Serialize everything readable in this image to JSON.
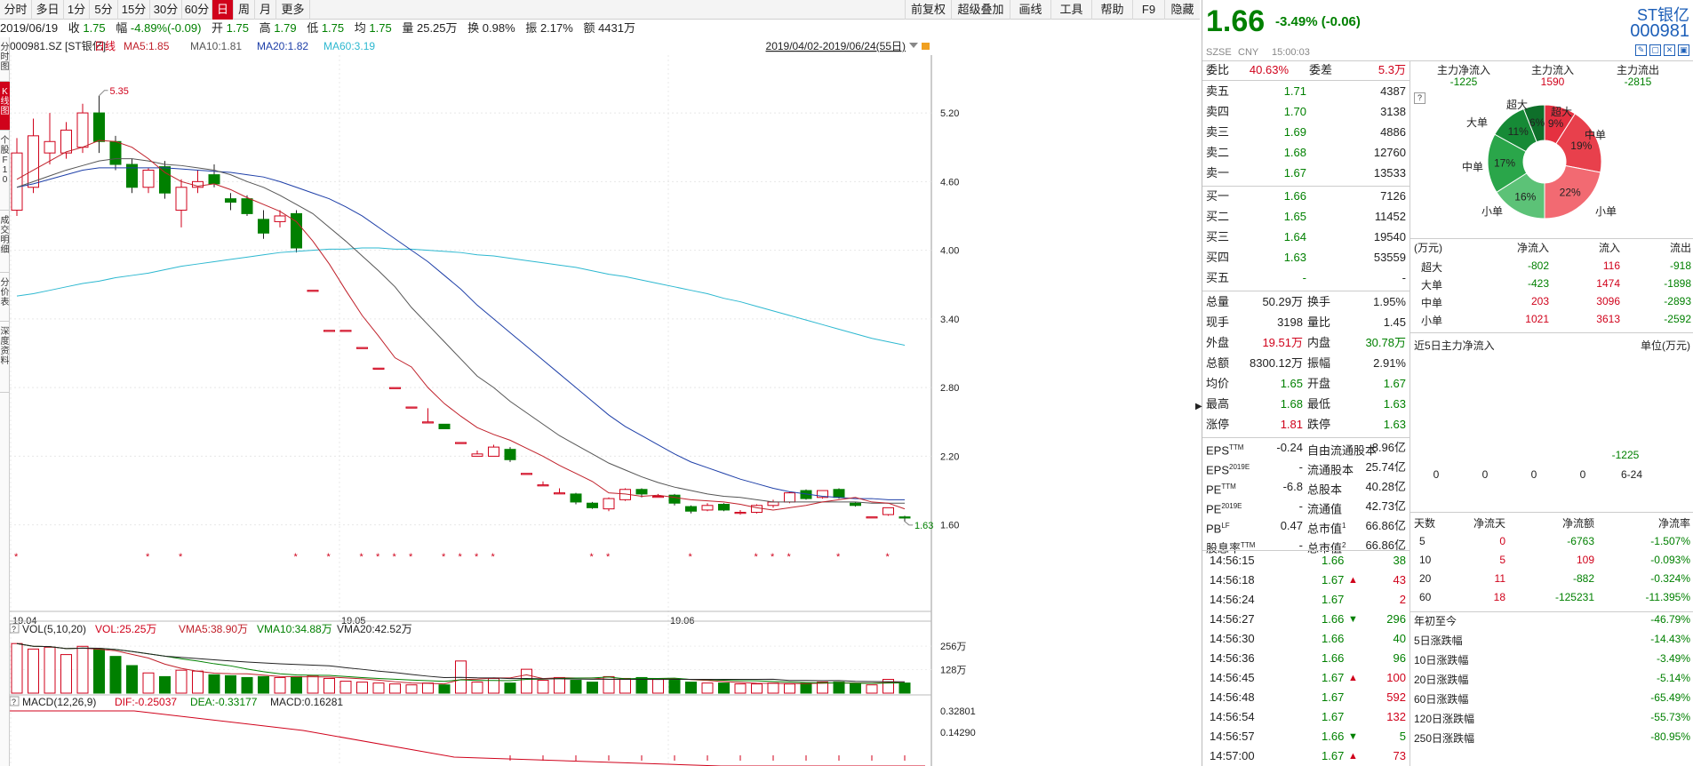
{
  "toolbar": {
    "periods": [
      {
        "label": "分时",
        "active": false
      },
      {
        "label": "多日",
        "active": false
      },
      {
        "label": "1分",
        "active": false
      },
      {
        "label": "5分",
        "active": false
      },
      {
        "label": "15分",
        "active": false
      },
      {
        "label": "30分",
        "active": false
      },
      {
        "label": "60分",
        "active": false
      },
      {
        "label": "日",
        "active": true
      },
      {
        "label": "周",
        "active": false
      },
      {
        "label": "月",
        "active": false
      },
      {
        "label": "更多",
        "active": false
      }
    ],
    "right_buttons": [
      "前复权",
      "超级叠加",
      "画线",
      "工具",
      "帮助",
      "F9",
      "隐藏"
    ]
  },
  "quote_line": {
    "date": "2019/06/19",
    "close_label": "收",
    "close": "1.75",
    "change_label": "幅",
    "change": "-4.89%(-0.09)",
    "open_label": "开",
    "open": "1.75",
    "high_label": "高",
    "high": "1.79",
    "low_label": "低",
    "low": "1.75",
    "avg_label": "均",
    "avg": "1.75",
    "volume_label": "量",
    "volume": "25.25万",
    "turnover_label": "换",
    "turnover": "0.98%",
    "amplitude_label": "振",
    "amplitude": "2.17%",
    "amount_label": "额",
    "amount": "4431万"
  },
  "left_nav": [
    "分时图",
    "K线图",
    "个股F10",
    "成交明细",
    "分价表",
    "深度资料"
  ],
  "chart_header": {
    "code": "000981.SZ [ST银亿]",
    "period": "日线",
    "ma5": "MA5:1.85",
    "ma10": "MA10:1.81",
    "ma20": "MA20:1.82",
    "ma60": "MA60:3.19",
    "range": "2019/04/02-2019/06/24(55日)",
    "peak_label": "5.35",
    "last_label": "1.63"
  },
  "colors": {
    "up": "#d0021b",
    "down": "#008000",
    "ma5": "#c0202a",
    "ma10": "#555",
    "ma20": "#1e3fa8",
    "ma60": "#2db8d0",
    "vol_ma5": "#c0202a",
    "vol_ma10": "#008000"
  },
  "chart_data": [
    {
      "type": "candlestick",
      "title": "000981.SZ [ST银亿] 日线",
      "ylim": [
        1.45,
        5.55
      ],
      "y_ticks": [
        "5.20",
        "4.60",
        "4.00",
        "3.40",
        "2.80",
        "2.20",
        "1.60"
      ],
      "x_labels": [
        {
          "label": "19.04",
          "index": 0
        },
        {
          "label": "19.05",
          "index": 20
        },
        {
          "label": "19.06",
          "index": 40
        }
      ],
      "candles": [
        [
          4.35,
          4.85,
          4.3,
          4.98
        ],
        [
          4.55,
          5.0,
          4.5,
          5.15
        ],
        [
          4.85,
          4.95,
          4.75,
          5.2
        ],
        [
          4.85,
          5.05,
          4.8,
          5.12
        ],
        [
          4.9,
          5.2,
          4.85,
          5.28
        ],
        [
          5.2,
          4.95,
          4.85,
          5.35
        ],
        [
          4.95,
          4.75,
          4.7,
          5.0
        ],
        [
          4.75,
          4.55,
          4.5,
          4.8
        ],
        [
          4.55,
          4.7,
          4.5,
          4.72
        ],
        [
          4.73,
          4.5,
          4.45,
          4.78
        ],
        [
          4.35,
          4.55,
          4.2,
          4.62
        ],
        [
          4.55,
          4.6,
          4.5,
          4.7
        ],
        [
          4.66,
          4.58,
          4.55,
          4.75
        ],
        [
          4.45,
          4.42,
          4.35,
          4.5
        ],
        [
          4.45,
          4.32,
          4.3,
          4.48
        ],
        [
          4.27,
          4.15,
          4.1,
          4.35
        ],
        [
          4.25,
          4.3,
          4.2,
          4.35
        ],
        [
          4.32,
          4.02,
          3.98,
          4.35
        ],
        [
          3.65,
          3.65,
          3.65,
          3.65
        ],
        [
          3.3,
          3.3,
          3.3,
          3.3
        ],
        [
          3.3,
          3.3,
          3.3,
          3.3
        ],
        [
          3.15,
          3.15,
          3.15,
          3.15
        ],
        [
          2.97,
          2.97,
          2.97,
          2.97
        ],
        [
          2.8,
          2.8,
          2.8,
          2.8
        ],
        [
          2.63,
          2.63,
          2.63,
          2.63
        ],
        [
          2.5,
          2.5,
          2.5,
          2.62
        ],
        [
          2.48,
          2.44,
          2.44,
          2.48
        ],
        [
          2.32,
          2.32,
          2.32,
          2.32
        ],
        [
          2.2,
          2.22,
          2.2,
          2.25
        ],
        [
          2.2,
          2.28,
          2.2,
          2.3
        ],
        [
          2.26,
          2.17,
          2.15,
          2.28
        ],
        [
          2.05,
          2.05,
          2.05,
          2.05
        ],
        [
          1.95,
          1.95,
          1.95,
          1.98
        ],
        [
          1.88,
          1.88,
          1.88,
          1.92
        ],
        [
          1.87,
          1.8,
          1.78,
          1.88
        ],
        [
          1.79,
          1.75,
          1.74,
          1.8
        ],
        [
          1.74,
          1.83,
          1.72,
          1.84
        ],
        [
          1.82,
          1.91,
          1.81,
          1.92
        ],
        [
          1.91,
          1.87,
          1.84,
          1.92
        ],
        [
          1.85,
          1.85,
          1.84,
          1.87
        ],
        [
          1.86,
          1.79,
          1.77,
          1.87
        ],
        [
          1.76,
          1.72,
          1.7,
          1.77
        ],
        [
          1.73,
          1.77,
          1.72,
          1.79
        ],
        [
          1.78,
          1.73,
          1.72,
          1.79
        ],
        [
          1.71,
          1.71,
          1.69,
          1.73
        ],
        [
          1.71,
          1.77,
          1.7,
          1.78
        ],
        [
          1.77,
          1.8,
          1.75,
          1.82
        ],
        [
          1.8,
          1.88,
          1.79,
          1.89
        ],
        [
          1.9,
          1.83,
          1.82,
          1.91
        ],
        [
          1.84,
          1.9,
          1.83,
          1.9
        ],
        [
          1.91,
          1.84,
          1.83,
          1.92
        ],
        [
          1.79,
          1.77,
          1.76,
          1.8
        ],
        [
          1.67,
          1.67,
          1.67,
          1.67
        ],
        [
          1.69,
          1.75,
          1.68,
          1.75
        ],
        [
          1.67,
          1.66,
          1.63,
          1.68
        ]
      ],
      "ma5": [
        4.62,
        4.7,
        4.78,
        4.86,
        4.9,
        4.96,
        4.95,
        4.9,
        4.8,
        4.68,
        4.6,
        4.56,
        4.58,
        4.53,
        4.46,
        4.4,
        4.34,
        4.25,
        4.08,
        3.88,
        3.65,
        3.43,
        3.25,
        3.06,
        2.98,
        2.8,
        2.66,
        2.55,
        2.45,
        2.39,
        2.34,
        2.27,
        2.2,
        2.12,
        2.05,
        1.98,
        1.88,
        1.87,
        1.85,
        1.86,
        1.84,
        1.82,
        1.81,
        1.8,
        1.78,
        1.75,
        1.73,
        1.75,
        1.77,
        1.8,
        1.82,
        1.84,
        1.8,
        1.79,
        1.74
      ],
      "ma10": [
        4.55,
        4.6,
        4.65,
        4.7,
        4.74,
        4.78,
        4.8,
        4.8,
        4.78,
        4.75,
        4.74,
        4.72,
        4.7,
        4.66,
        4.6,
        4.55,
        4.48,
        4.4,
        4.32,
        4.2,
        4.08,
        3.95,
        3.82,
        3.68,
        3.5,
        3.35,
        3.2,
        3.05,
        2.9,
        2.8,
        2.68,
        2.58,
        2.48,
        2.38,
        2.3,
        2.22,
        2.14,
        2.08,
        2.02,
        1.97,
        1.93,
        1.9,
        1.87,
        1.85,
        1.84,
        1.82,
        1.8,
        1.8,
        1.8,
        1.8,
        1.8,
        1.8,
        1.79,
        1.79,
        1.79
      ],
      "ma20": [
        4.55,
        4.58,
        4.62,
        4.66,
        4.7,
        4.72,
        4.72,
        4.72,
        4.72,
        4.72,
        4.71,
        4.7,
        4.69,
        4.68,
        4.66,
        4.64,
        4.6,
        4.55,
        4.5,
        4.45,
        4.38,
        4.3,
        4.2,
        4.1,
        4.0,
        3.9,
        3.78,
        3.66,
        3.52,
        3.4,
        3.28,
        3.16,
        3.04,
        2.92,
        2.8,
        2.68,
        2.56,
        2.46,
        2.38,
        2.3,
        2.22,
        2.15,
        2.1,
        2.05,
        2.0,
        1.96,
        1.92,
        1.89,
        1.87,
        1.85,
        1.84,
        1.83,
        1.83,
        1.82,
        1.82
      ],
      "ma60": [
        3.6,
        3.62,
        3.65,
        3.68,
        3.71,
        3.73,
        3.76,
        3.78,
        3.8,
        3.83,
        3.86,
        3.88,
        3.9,
        3.92,
        3.94,
        3.96,
        3.98,
        3.99,
        4.0,
        4.01,
        4.01,
        4.02,
        4.02,
        4.01,
        4.01,
        4.0,
        3.99,
        3.98,
        3.96,
        3.95,
        3.93,
        3.91,
        3.89,
        3.87,
        3.85,
        3.82,
        3.79,
        3.77,
        3.74,
        3.71,
        3.68,
        3.65,
        3.62,
        3.58,
        3.55,
        3.51,
        3.47,
        3.43,
        3.39,
        3.35,
        3.31,
        3.27,
        3.23,
        3.2,
        3.17
      ],
      "markers": [
        0,
        8,
        10,
        17,
        19,
        21,
        22,
        23,
        24,
        26,
        27,
        28,
        29,
        35,
        36,
        41,
        45,
        46,
        47,
        50,
        53
      ]
    },
    {
      "type": "bar",
      "title": "VOL(5,10,20)",
      "vol": "VOL:25.25万",
      "vma5": "VMA5:38.90万",
      "vma10": "VMA10:34.88万",
      "vma20": "VMA20:42.52万",
      "y_ticks": [
        "256万",
        "128万"
      ],
      "ylim": [
        0,
        300
      ],
      "values": [
        270,
        240,
        250,
        210,
        255,
        240,
        200,
        150,
        110,
        90,
        125,
        120,
        100,
        95,
        85,
        90,
        85,
        90,
        95,
        80,
        65,
        60,
        55,
        50,
        45,
        55,
        45,
        175,
        60,
        80,
        55,
        130,
        70,
        85,
        70,
        60,
        90,
        80,
        85,
        75,
        70,
        60,
        55,
        55,
        50,
        50,
        55,
        50,
        55,
        60,
        60,
        50,
        45,
        75,
        55
      ]
    },
    {
      "type": "bar",
      "title": "MACD(12,26,9)",
      "dif": "DIF:-0.25037",
      "dea": "DEA:-0.33177",
      "macd": "MACD:0.16281",
      "y_ticks": [
        "0.32801",
        "0.14290"
      ]
    }
  ],
  "right_panel": {
    "price": "1.66",
    "change": "-3.49% (-0.06)",
    "name": "ST银亿",
    "code": "000981",
    "exchange": "SZSE",
    "currency": "CNY",
    "time": "15:00:03",
    "ratio_label": "委比",
    "ratio": "40.63%",
    "diff_label": "委差",
    "diff": "5.3万",
    "sells": [
      {
        "label": "卖五",
        "price": "1.71",
        "vol": "4387"
      },
      {
        "label": "卖四",
        "price": "1.70",
        "vol": "3138"
      },
      {
        "label": "卖三",
        "price": "1.69",
        "vol": "4886"
      },
      {
        "label": "卖二",
        "price": "1.68",
        "vol": "12760"
      },
      {
        "label": "卖一",
        "price": "1.67",
        "vol": "13533"
      }
    ],
    "buys": [
      {
        "label": "买一",
        "price": "1.66",
        "vol": "7126"
      },
      {
        "label": "买二",
        "price": "1.65",
        "vol": "11452"
      },
      {
        "label": "买三",
        "price": "1.64",
        "vol": "19540"
      },
      {
        "label": "买四",
        "price": "1.63",
        "vol": "53559"
      },
      {
        "label": "买五",
        "price": "-",
        "vol": "-"
      }
    ],
    "stats": [
      {
        "l1": "总量",
        "v1": "50.29万",
        "c1": "k",
        "l2": "换手",
        "v2": "1.95%",
        "c2": "k"
      },
      {
        "l1": "现手",
        "v1": "3198",
        "c1": "k",
        "l2": "量比",
        "v2": "1.45",
        "c2": "k"
      },
      {
        "l1": "外盘",
        "v1": "19.51万",
        "c1": "r",
        "l2": "内盘",
        "v2": "30.78万",
        "c2": "g"
      },
      {
        "l1": "总额",
        "v1": "8300.12万",
        "c1": "k",
        "l2": "振幅",
        "v2": "2.91%",
        "c2": "k"
      },
      {
        "l1": "均价",
        "v1": "1.65",
        "c1": "g",
        "l2": "开盘",
        "v2": "1.67",
        "c2": "g"
      },
      {
        "l1": "最高",
        "v1": "1.68",
        "c1": "g",
        "l2": "最低",
        "v2": "1.63",
        "c2": "g"
      },
      {
        "l1": "涨停",
        "v1": "1.81",
        "c1": "r",
        "l2": "跌停",
        "v2": "1.63",
        "c2": "g"
      }
    ],
    "fundamentals": [
      {
        "l1": "EPS",
        "s1": "TTM",
        "v1": "-0.24",
        "l2": "自由流通股本",
        "s2": "",
        "v2": "8.96亿"
      },
      {
        "l1": "EPS",
        "s1": "2019E",
        "v1": "-",
        "l2": "流通股本",
        "s2": "",
        "v2": "25.74亿"
      },
      {
        "l1": "PE",
        "s1": "TTM",
        "v1": "-6.8",
        "l2": "总股本",
        "s2": "",
        "v2": "40.28亿"
      },
      {
        "l1": "PE",
        "s1": "2019E",
        "v1": "-",
        "l2": "流通值",
        "s2": "",
        "v2": "42.73亿"
      },
      {
        "l1": "PB",
        "s1": "LF",
        "v1": "0.47",
        "l2": "总市值",
        "s2": "1",
        "v2": "66.86亿"
      },
      {
        "l1": "股息率",
        "s1": "TTM",
        "v1": "-",
        "l2": "总市值",
        "s2": "2",
        "v2": "66.86亿"
      }
    ],
    "ticks": [
      {
        "time": "14:56:15",
        "price": "1.66",
        "dir": "",
        "vol": "38",
        "vc": "g"
      },
      {
        "time": "14:56:18",
        "price": "1.67",
        "dir": "up",
        "vol": "43",
        "vc": "r"
      },
      {
        "time": "14:56:24",
        "price": "1.67",
        "dir": "",
        "vol": "2",
        "vc": "r"
      },
      {
        "time": "14:56:27",
        "price": "1.66",
        "dir": "down",
        "vol": "296",
        "vc": "g"
      },
      {
        "time": "14:56:30",
        "price": "1.66",
        "dir": "",
        "vol": "40",
        "vc": "g"
      },
      {
        "time": "14:56:36",
        "price": "1.66",
        "dir": "",
        "vol": "96",
        "vc": "g"
      },
      {
        "time": "14:56:45",
        "price": "1.67",
        "dir": "up",
        "vol": "100",
        "vc": "r"
      },
      {
        "time": "14:56:48",
        "price": "1.67",
        "dir": "",
        "vol": "592",
        "vc": "r"
      },
      {
        "time": "14:56:54",
        "price": "1.67",
        "dir": "",
        "vol": "132",
        "vc": "r"
      },
      {
        "time": "14:56:57",
        "price": "1.66",
        "dir": "down",
        "vol": "5",
        "vc": "g"
      },
      {
        "time": "14:57:00",
        "price": "1.67",
        "dir": "up",
        "vol": "73",
        "vc": "r"
      }
    ],
    "flow": {
      "inflow_label": "主力净流入",
      "inflow": "-1225",
      "in_label": "主力流入",
      "in": "1590",
      "out_label": "主力流出",
      "out": "-2815",
      "pie": [
        {
          "name": "超大",
          "pct": "9%",
          "value": 9,
          "color": "#e53040"
        },
        {
          "name": "中单",
          "pct": "19%",
          "value": 19,
          "color": "#e8404c"
        },
        {
          "name": "小单",
          "pct": "22%",
          "value": 22,
          "color": "#f26a72"
        },
        {
          "name": "小单",
          "pct": "16%",
          "value": 16,
          "color": "#5cc277"
        },
        {
          "name": "中单",
          "pct": "17%",
          "value": 17,
          "color": "#2aa64a"
        },
        {
          "name": "大单",
          "pct": "11%",
          "value": 11,
          "color": "#168a36"
        },
        {
          "name": "超大",
          "pct": "6%",
          "value": 6,
          "color": "#0e6f2a"
        }
      ],
      "table_head": [
        "(万元)",
        "净流入",
        "流入",
        "流出"
      ],
      "table": [
        {
          "name": "超大",
          "net": "-802",
          "in": "116",
          "out": "-918"
        },
        {
          "name": "大单",
          "net": "-423",
          "in": "1474",
          "out": "-1898"
        },
        {
          "name": "中单",
          "net": "203",
          "in": "3096",
          "out": "-2893"
        },
        {
          "name": "小单",
          "net": "1021",
          "in": "3613",
          "out": "-2592"
        }
      ],
      "five_day_label": "近5日主力净流入",
      "unit_label": "单位(万元)",
      "five_day": [
        0,
        0,
        0,
        0,
        -1225
      ],
      "five_day_labels": [
        "0",
        "0",
        "0",
        "0",
        "6-24"
      ],
      "five_day_value_label": "-1225",
      "stats_head": [
        "天数",
        "净流天",
        "净流额",
        "净流率"
      ],
      "stats": [
        {
          "d": "5",
          "days": "0",
          "amt": "-6763",
          "rate": "-1.507%"
        },
        {
          "d": "10",
          "days": "5",
          "amt": "109",
          "rate": "-0.093%"
        },
        {
          "d": "20",
          "days": "11",
          "amt": "-882",
          "rate": "-0.324%"
        },
        {
          "d": "60",
          "days": "18",
          "amt": "-125231",
          "rate": "-11.395%"
        }
      ],
      "perf": [
        {
          "label": "年初至今",
          "value": "-46.79%"
        },
        {
          "label": "5日涨跌幅",
          "value": "-14.43%"
        },
        {
          "label": "10日涨跌幅",
          "value": "-3.49%"
        },
        {
          "label": "20日涨跌幅",
          "value": "-5.14%"
        },
        {
          "label": "60日涨跌幅",
          "value": "-65.49%"
        },
        {
          "label": "120日涨跌幅",
          "value": "-55.73%"
        },
        {
          "label": "250日涨跌幅",
          "value": "-80.95%"
        }
      ]
    }
  }
}
